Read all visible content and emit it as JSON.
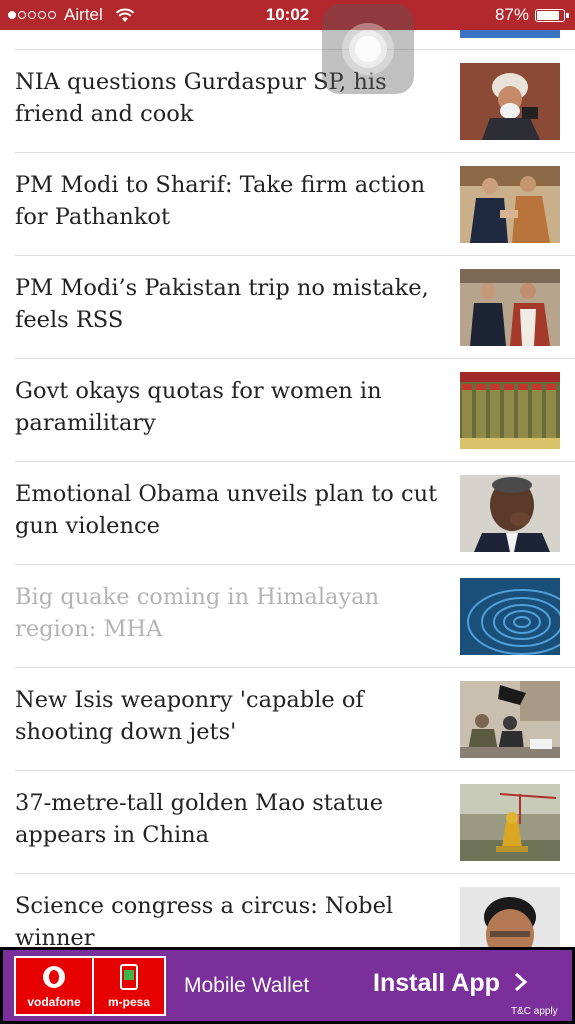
{
  "status_bar": {
    "carrier": "Airtel",
    "time": "10:02",
    "battery": "87%",
    "battery_fraction": 0.87,
    "signal_bars": 1,
    "signal_total": 5
  },
  "news": [
    {
      "title": "NIA questions Gurdaspur SP, his friend and cook",
      "read": false,
      "image": "man-in-turban-photo"
    },
    {
      "title": "PM Modi to Sharif: Take firm action for Pathankot",
      "read": false,
      "image": "leaders-handshake-photo"
    },
    {
      "title": "PM Modi’s Pakistan trip no mistake, feels RSS",
      "read": false,
      "image": "leaders-meeting-photo"
    },
    {
      "title": "Govt okays quotas for women in paramilitary",
      "read": false,
      "image": "paramilitary-parade-photo"
    },
    {
      "title": "Emotional Obama unveils plan to cut gun violence",
      "read": false,
      "image": "obama-wiping-tear-photo"
    },
    {
      "title": "Big quake coming in Himalayan region: MHA",
      "read": true,
      "image": "seismic-waves-photo"
    },
    {
      "title": "New Isis weaponry 'capable of shooting down jets'",
      "read": false,
      "image": "armed-fighters-photo"
    },
    {
      "title": "37-metre-tall golden Mao statue appears in China",
      "read": false,
      "image": "golden-statue-photo"
    },
    {
      "title": "Science congress a circus: Nobel winner",
      "read": false,
      "image": "scientist-portrait-photo"
    }
  ],
  "ad": {
    "vodafone": "vodafone",
    "mpesa": "m-pesa",
    "wallet": "Mobile Wallet",
    "install": "Install App",
    "tnc": "T&C apply"
  },
  "colors": {
    "status_bar_bg": "#b3282d",
    "ad_bg": "#7a2f9b",
    "vodafone_red": "#e60000",
    "read_text": "#b4b4b4",
    "text": "#222222"
  }
}
